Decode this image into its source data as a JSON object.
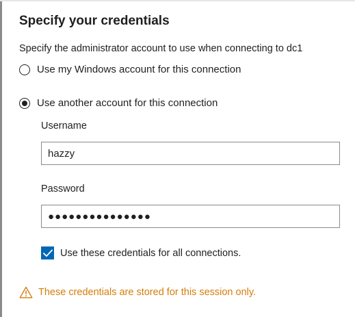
{
  "dialog": {
    "title": "Specify your credentials",
    "description": "Specify the administrator account to use when connecting to dc1"
  },
  "options": {
    "windows_account_label": "Use my Windows account for this connection",
    "windows_account_selected": false,
    "another_account_label": "Use another account for this connection",
    "another_account_selected": true
  },
  "fields": {
    "username_label": "Username",
    "username_value": "hazzy",
    "password_label": "Password",
    "password_masked": "●●●●●●●●●●●●●●●"
  },
  "checkbox": {
    "label": "Use these credentials for all connections.",
    "checked": true
  },
  "warning": {
    "text": "These credentials are stored for this session only.",
    "icon": "warning-triangle-icon"
  },
  "colors": {
    "accent": "#0067b8",
    "warning": "#d57d0b",
    "text": "#1f1f1f",
    "border": "#8a8a8a"
  }
}
